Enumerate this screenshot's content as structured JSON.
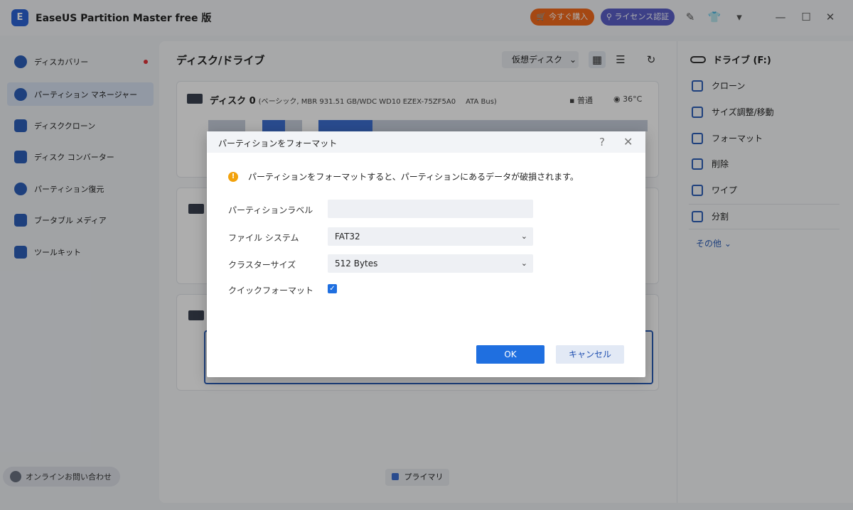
{
  "app": {
    "title": "EaseUS Partition Master free 版",
    "buy_label": "今すぐ購入",
    "license_label": "ライセンス認証"
  },
  "sidebar": {
    "items": [
      {
        "label": "ディスカバリー"
      },
      {
        "label": "パーティション マネージャー"
      },
      {
        "label": "ディスククローン"
      },
      {
        "label": "ディスク コンバーター"
      },
      {
        "label": "パーティション復元"
      },
      {
        "label": "ブータブル メディア"
      },
      {
        "label": "ツールキット"
      }
    ],
    "support_label": "オンラインお問い合わせ"
  },
  "main": {
    "title": "ディスク/ドライブ",
    "virtual_disk_label": "仮想ディスク",
    "disk0": {
      "name": "ディスク 0",
      "detail": "(ベーシック, MBR 931.51 GB/WDC WD10 EZEX-75ZF5A0",
      "bus": "ATA Bus)",
      "health": "普通",
      "temp": "36°C"
    },
    "legend_primary": "プライマリ"
  },
  "right_pane": {
    "drive_title": "ドライブ (F:)",
    "actions": [
      {
        "label": "クローン"
      },
      {
        "label": "サイズ調整/移動"
      },
      {
        "label": "フォーマット"
      },
      {
        "label": "削除"
      },
      {
        "label": "ワイプ"
      },
      {
        "label": "分割"
      }
    ],
    "more_label": "その他"
  },
  "dialog": {
    "title": "パーティションをフォーマット",
    "warning": "パーティションをフォーマットすると、パーティションにあるデータが破損されます。",
    "label_field": {
      "label": "パーティションラベル",
      "value": ""
    },
    "filesystem": {
      "label": "ファイル システム",
      "value": "FAT32"
    },
    "cluster": {
      "label": "クラスターサイズ",
      "value": "512 Bytes"
    },
    "quick_format": {
      "label": "クイックフォーマット",
      "checked": true
    },
    "ok_label": "OK",
    "cancel_label": "キャンセル"
  },
  "colors": {
    "accent": "#1f6fe0",
    "buy": "#f36b1c",
    "license": "#5a5fc8",
    "warning": "#f2a20c"
  }
}
